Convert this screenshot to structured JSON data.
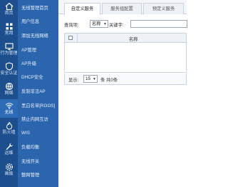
{
  "rail": {
    "items": [
      {
        "label": "首页",
        "icon": "home-icon"
      },
      {
        "label": "常用",
        "icon": "grid-icon"
      },
      {
        "label": "行为管理",
        "icon": "monitor-icon"
      },
      {
        "label": "安全认证",
        "icon": "shield-icon"
      },
      {
        "label": "网络",
        "icon": "network-icon"
      },
      {
        "label": "无线",
        "icon": "wifi-icon",
        "active": true
      },
      {
        "label": "防火墙",
        "icon": "firewall-icon"
      },
      {
        "label": "运维",
        "icon": "wrench-icon"
      },
      {
        "label": "高级",
        "icon": "gear-icon"
      }
    ]
  },
  "submenu": {
    "items": [
      "无线管理首页",
      "用户信息",
      "添加无线网络",
      "AP管理",
      "AP升级",
      "DHCP安全",
      "反制非法AP",
      "黑白名单[RGOS]",
      "禁止内网互访",
      "WIS",
      "负载均衡",
      "无线开关",
      "整网管理"
    ]
  },
  "tabs": [
    "自定义服务",
    "服务组配置",
    "预定义服务"
  ],
  "search": {
    "query_label": "查询项:",
    "query_field": "名称",
    "keyword_label": "关键字:",
    "keyword_value": ""
  },
  "grid": {
    "columns": [
      "名称"
    ]
  },
  "pager": {
    "show_label": "显示:",
    "page_size": "15",
    "per_page_label": "条 共0条"
  },
  "colors": {
    "rail_bg": "#1d4f8f",
    "submenu_bg": "#2a65ad",
    "active_item": "#3a7bc8"
  }
}
